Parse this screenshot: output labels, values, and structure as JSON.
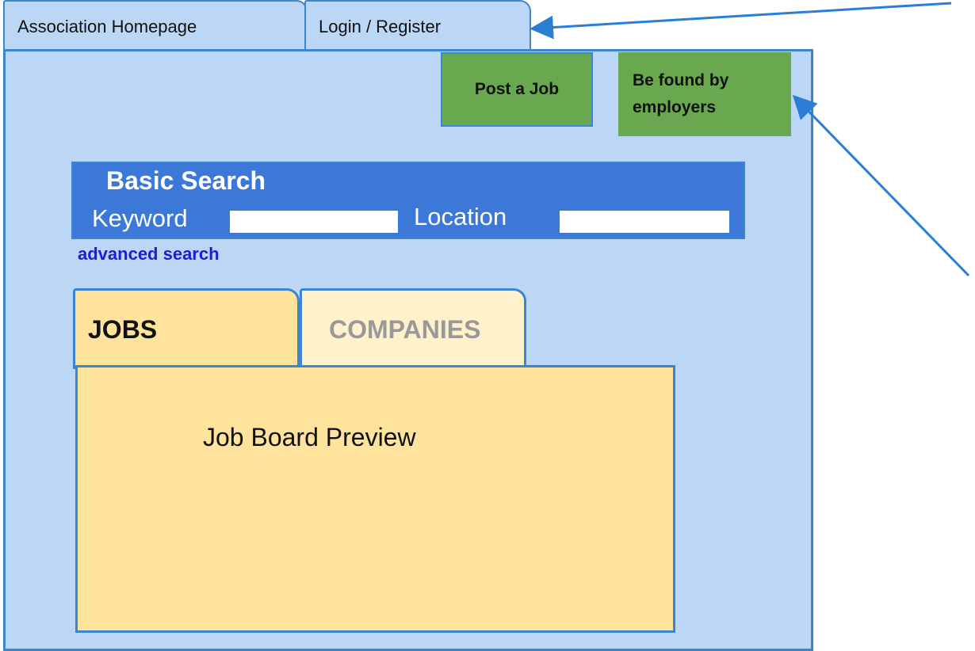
{
  "top_tabs": {
    "home": "Association Homepage",
    "login": "Login / Register"
  },
  "buttons": {
    "post_job": "Post a Job",
    "be_found": "Be found by employers"
  },
  "search": {
    "title": "Basic Search",
    "keyword_label": "Keyword",
    "keyword_value": "",
    "location_label": "Location",
    "location_value": "",
    "advanced_link": "advanced search"
  },
  "content_tabs": {
    "jobs": "JOBS",
    "companies": "COMPANIES",
    "active": "JOBS"
  },
  "preview": {
    "label": "Job Board Preview"
  },
  "colors": {
    "panel_bg": "#bcd7f5",
    "border": "#3a86d1",
    "button_green": "#69a84f",
    "search_bar": "#3b78d8",
    "tab_active": "#fde39c",
    "tab_inactive": "#fff1c9",
    "link": "#1c1ed6",
    "annotation_arrow": "#2a7fd4"
  }
}
